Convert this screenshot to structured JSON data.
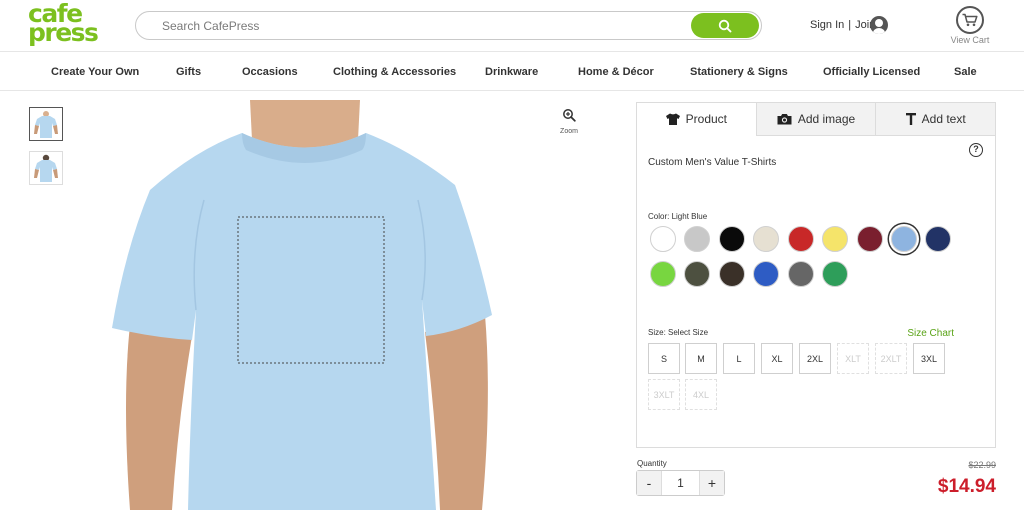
{
  "header": {
    "logo_line1": "cafe",
    "logo_line2": "press",
    "search_placeholder": "Search CafePress",
    "sign_in": "Sign In",
    "separator": "|",
    "join": "Join",
    "view_cart": "View Cart"
  },
  "nav": {
    "items": [
      {
        "label": "Create Your Own"
      },
      {
        "label": "Gifts"
      },
      {
        "label": "Occasions"
      },
      {
        "label": "Clothing & Accessories"
      },
      {
        "label": "Drinkware"
      },
      {
        "label": "Home & Décor"
      },
      {
        "label": "Stationery & Signs"
      },
      {
        "label": "Officially Licensed"
      },
      {
        "label": "Sale"
      }
    ]
  },
  "viewer": {
    "zoom_label": "Zoom",
    "shirt_color": "#b6d7ef"
  },
  "panel": {
    "tabs": [
      {
        "label": "Product",
        "icon": "tshirt-icon"
      },
      {
        "label": "Add image",
        "icon": "camera-icon"
      },
      {
        "label": "Add text",
        "icon": "text-icon"
      }
    ],
    "product_name": "Custom Men's Value T-Shirts",
    "help_icon": "?",
    "color_label": "Color:  Light Blue",
    "selected_color": "Light Blue",
    "colors": [
      "#ffffff",
      "#c8c8c8",
      "#0a0a0a",
      "#e6e0d2",
      "#c82828",
      "#f5e46a",
      "#7a1f2e",
      "#8eb4e0",
      "#223366",
      "#78d640",
      "#4d5040",
      "#3a3028",
      "#2e5cc4",
      "#666666",
      "#2e9e5a"
    ],
    "size_label": "Size:  Select Size",
    "size_chart": "Size Chart",
    "sizes": [
      {
        "label": "S",
        "available": true
      },
      {
        "label": "M",
        "available": true
      },
      {
        "label": "L",
        "available": true
      },
      {
        "label": "XL",
        "available": true
      },
      {
        "label": "2XL",
        "available": true
      },
      {
        "label": "XLT",
        "available": false
      },
      {
        "label": "2XLT",
        "available": false
      },
      {
        "label": "3XL",
        "available": true
      },
      {
        "label": "3XLT",
        "available": false
      },
      {
        "label": "4XL",
        "available": false
      }
    ]
  },
  "purchase": {
    "quantity_label": "Quantity",
    "quantity": "1",
    "minus": "-",
    "plus": "+",
    "old_price": "$22.99",
    "price": "$14.94"
  },
  "colors": {
    "brand_green": "#7cc01f",
    "price_red": "#cc1e2b"
  }
}
